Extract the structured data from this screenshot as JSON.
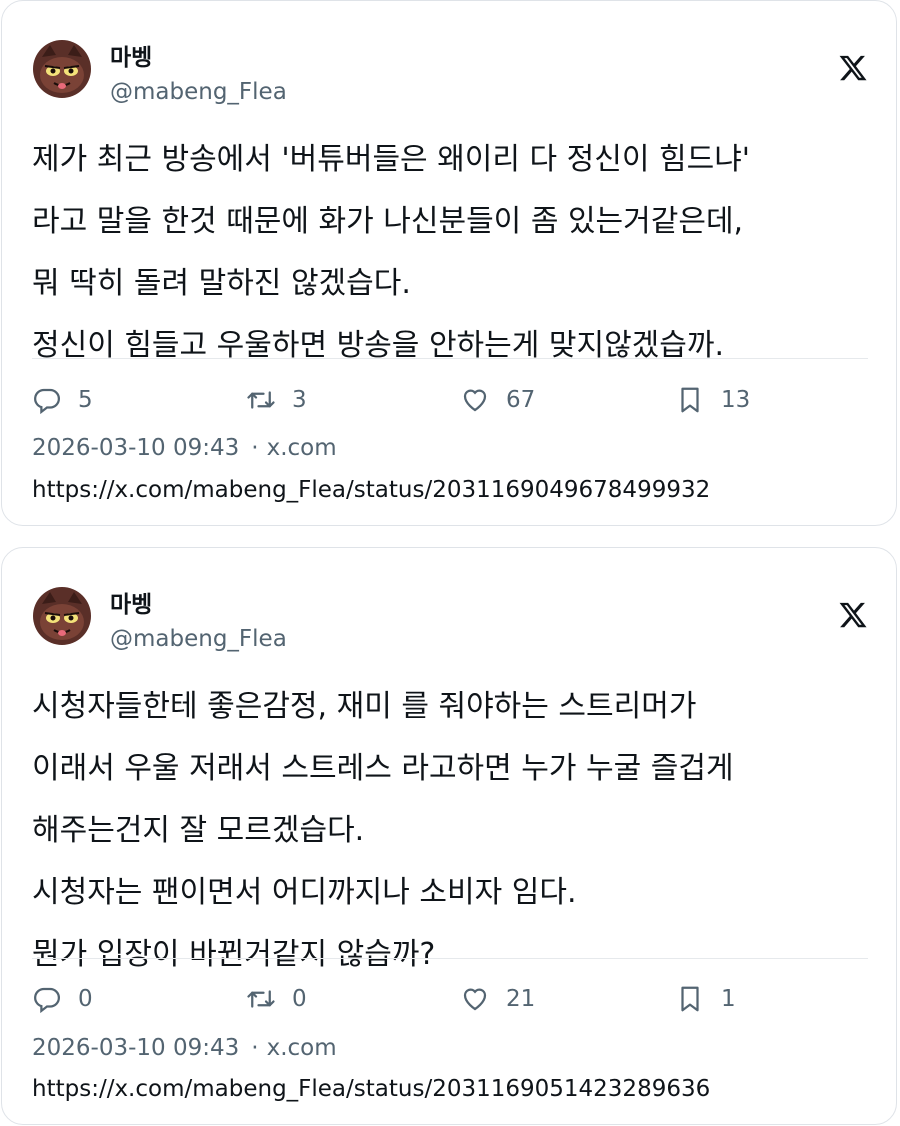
{
  "tweets": [
    {
      "author_name": "마벵",
      "author_handle": "@mabeng_Flea",
      "lines": [
        "제가 최근 방송에서 '버튜버들은 왜이리 다 정신이 힘드냐'",
        "라고 말을 한것 때문에 화가 나신분들이 좀 있는거같은데,",
        "뭐 딱히 돌려 말하진 않겠습다.",
        "정신이 힘들고 우울하면 방송을 안하는게 맞지않겠습까."
      ],
      "replies": "5",
      "reposts": "3",
      "likes": "67",
      "bookmarks": "13",
      "timestamp": "2026-03-10 09:43",
      "source": "x.com",
      "url": "https://x.com/mabeng_Flea/status/2031169049678499932"
    },
    {
      "author_name": "마벵",
      "author_handle": "@mabeng_Flea",
      "lines": [
        "시청자들한테 좋은감정, 재미 를 줘야하는 스트리머가",
        "이래서 우울 저래서 스트레스 라고하면 누가 누굴 즐겁게",
        "해주는건지 잘 모르겠습다.",
        "시청자는 팬이면서 어디까지나 소비자 임다.",
        "뭔가 입장이 바뀐거같지 않습까?"
      ],
      "replies": "0",
      "reposts": "0",
      "likes": "21",
      "bookmarks": "1",
      "timestamp": "2026-03-10 09:43",
      "source": "x.com",
      "url": "https://x.com/mabeng_Flea/status/2031169051423289636"
    }
  ],
  "icons": {
    "reply": "reply-icon",
    "repost": "repost-icon",
    "like": "heart-icon",
    "bookmark": "bookmark-icon",
    "logo": "x-logo-icon",
    "avatar": "avatar-image"
  },
  "colors": {
    "text": "#0f1419",
    "muted": "#536471",
    "border": "#dfe3e8"
  }
}
